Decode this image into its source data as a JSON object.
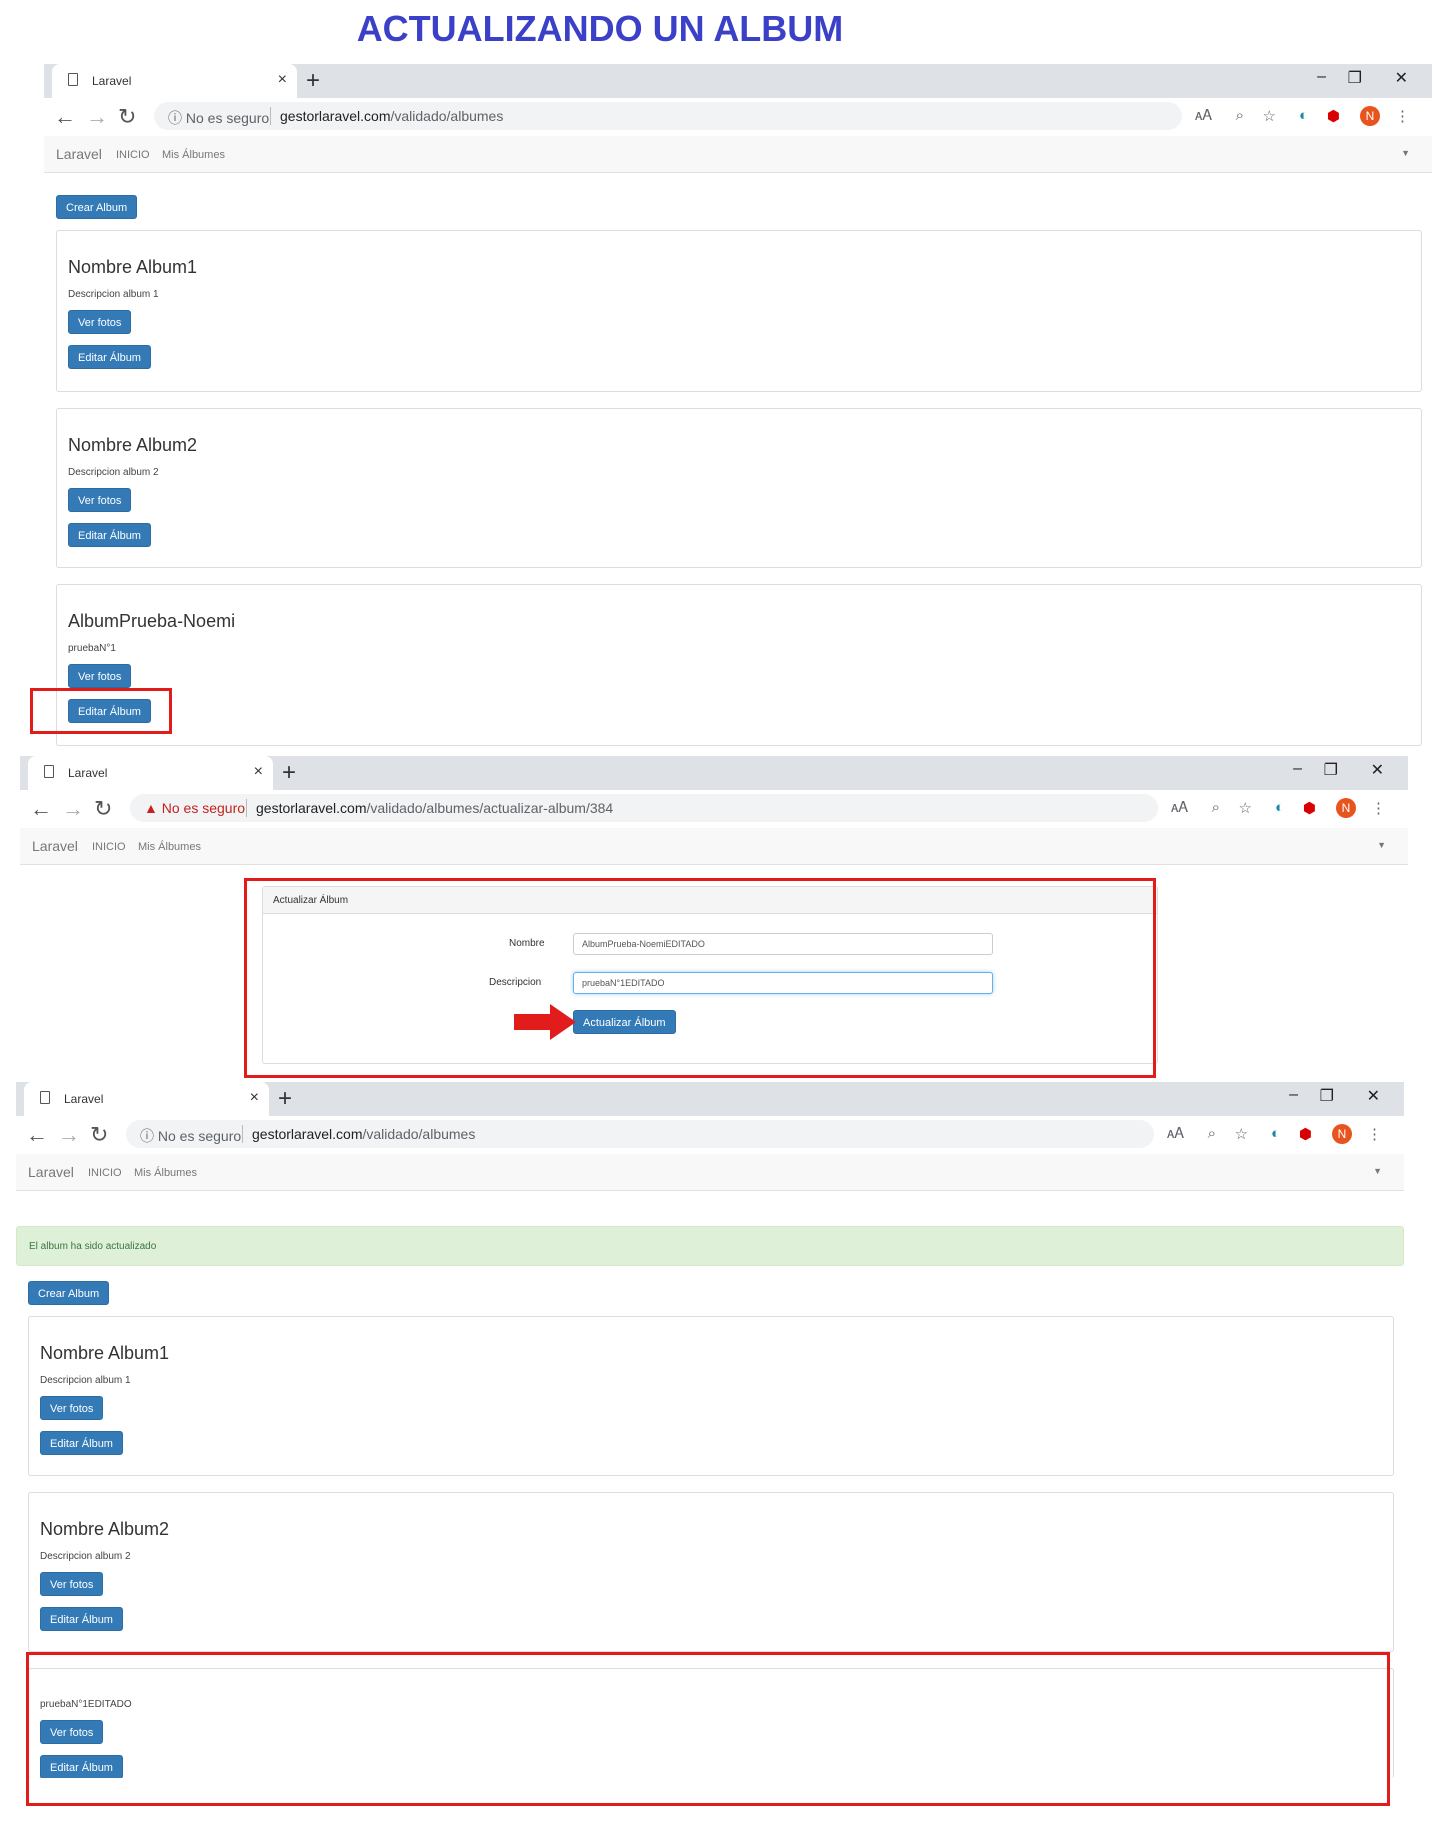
{
  "heading": "ACTUALIZANDO UN ALBUM",
  "browser": {
    "tab_title": "Laravel",
    "insecure_label": "No es seguro",
    "url_host": "gestorlaravel.com",
    "url_path_list": "/validado/albumes",
    "url_path_edit": "/validado/albumes/actualizar-album/384",
    "avatar_initial": "N"
  },
  "navbar": {
    "brand": "Laravel",
    "link_home": "INICIO",
    "link_albums": "Mis Álbumes"
  },
  "buttons": {
    "create": "Crear Album",
    "view_photos": "Ver fotos",
    "edit": "Editar Álbum"
  },
  "screen1": {
    "albums": [
      {
        "name": "Nombre Album1",
        "description": "Descripcion album 1"
      },
      {
        "name": "Nombre Album2",
        "description": "Descripcion album 2"
      },
      {
        "name": "AlbumPrueba-Noemi",
        "description": "pruebaN°1"
      }
    ]
  },
  "screen2": {
    "panel_title": "Actualizar Álbum",
    "name_label": "Nombre",
    "name_value": "AlbumPrueba-NoemiEDITADO",
    "desc_label": "Descripcion",
    "desc_value": "pruebaN°1EDITADO",
    "submit": "Actualizar Álbum"
  },
  "screen3": {
    "alert": "El album ha sido actualizado",
    "albums": [
      {
        "name": "Nombre Album1",
        "description": "Descripcion album 1"
      },
      {
        "name": "Nombre Album2",
        "description": "Descripcion album 2"
      },
      {
        "name": "",
        "description": "pruebaN°1EDITADO"
      }
    ]
  },
  "colors": {
    "heading": "#3b40c9",
    "primary_button": "#337ab7",
    "highlight": "#e21b1b",
    "success_bg": "#dff0d8"
  }
}
